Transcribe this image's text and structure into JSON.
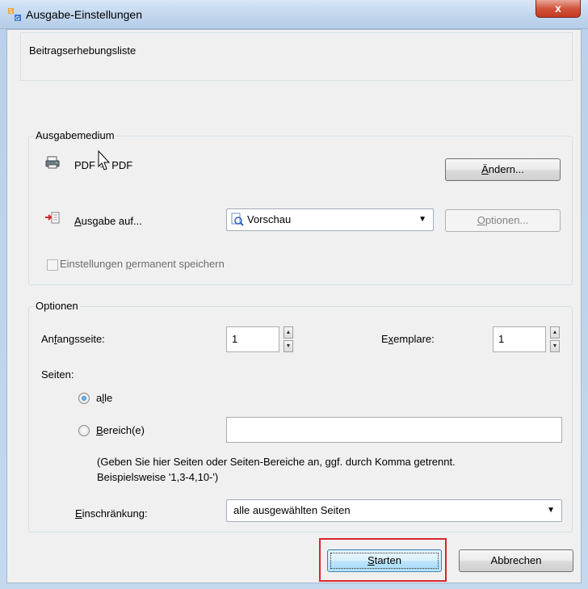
{
  "window": {
    "title": "Ausgabe-Einstellungen",
    "close_glyph": "x",
    "app_icon": "sg-app-icon"
  },
  "header": {
    "report_name": "Beitragserhebungsliste"
  },
  "ausgabemedium": {
    "group_label": "Ausgabemedium",
    "printer_icon": "printer-icon",
    "printer_name": "PDF → PDF",
    "aendern_button": {
      "pre": "",
      "mnemonic": "Ä",
      "post": "ndern..."
    },
    "ausgabe_auf_label": {
      "mnemonic": "A",
      "post": "usgabe auf..."
    },
    "ausgabe_auf_select": {
      "value": "Vorschau"
    },
    "optionen_button": {
      "mnemonic": "O",
      "post": "ptionen..."
    },
    "permanent_checkbox": {
      "pre": "Einstellungen ",
      "mnemonic": "p",
      "post": "ermanent speichern",
      "checked": false
    }
  },
  "optionen": {
    "group_label": "Optionen",
    "anfangsseite_label": {
      "pre": "An",
      "mnemonic": "f",
      "post": "angsseite:"
    },
    "anfangsseite_value": "1",
    "exemplare_label": {
      "pre": "E",
      "mnemonic": "x",
      "post": "emplare:"
    },
    "exemplare_value": "1",
    "seiten_label": "Seiten:",
    "radio_alle": {
      "pre": "a",
      "mnemonic": "l",
      "post": "le",
      "selected": true
    },
    "radio_bereich": {
      "pre": "",
      "mnemonic": "B",
      "post": "ereich(e)",
      "selected": false
    },
    "bereich_value": "",
    "hint_line1": "(Geben Sie hier Seiten oder Seiten-Bereiche an, ggf. durch Komma getrennt.",
    "hint_line2": "Beispielsweise '1,3-4,10-')",
    "einschraenkung_label": {
      "pre": "",
      "mnemonic": "E",
      "post": "inschränkung:"
    },
    "einschraenkung_select": {
      "value": "alle ausgewählten Seiten"
    }
  },
  "footer": {
    "start_button": {
      "mnemonic": "S",
      "post": "tarten"
    },
    "cancel_button": "Abbrechen"
  },
  "colors": {
    "highlight": "#d8262e",
    "default_button_border": "#3c7fb1"
  }
}
